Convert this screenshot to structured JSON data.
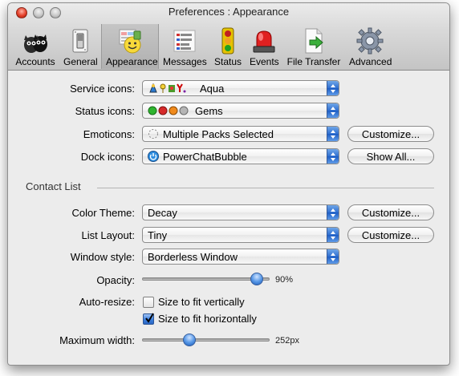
{
  "window": {
    "title": "Preferences : Appearance"
  },
  "toolbar": {
    "items": [
      {
        "label": "Accounts",
        "icon": "accounts-icon"
      },
      {
        "label": "General",
        "icon": "general-switch-icon"
      },
      {
        "label": "Appearance",
        "icon": "appearance-smiley-icon",
        "selected": true
      },
      {
        "label": "Messages",
        "icon": "messages-icon"
      },
      {
        "label": "Status",
        "icon": "traffic-light-icon"
      },
      {
        "label": "Events",
        "icon": "siren-icon"
      },
      {
        "label": "File Transfer",
        "icon": "file-transfer-icon"
      },
      {
        "label": "Advanced",
        "icon": "gear-icon"
      }
    ]
  },
  "appearance": {
    "service_icons": {
      "label": "Service icons:",
      "value": "Aqua"
    },
    "status_icons": {
      "label": "Status icons:",
      "value": "Gems"
    },
    "emoticons": {
      "label": "Emoticons:",
      "value": "Multiple Packs Selected",
      "button": "Customize..."
    },
    "dock_icons": {
      "label": "Dock icons:",
      "value": "PowerChatBubble",
      "button": "Show All..."
    }
  },
  "contact_list": {
    "section_title": "Contact List",
    "color_theme": {
      "label": "Color Theme:",
      "value": "Decay",
      "button": "Customize..."
    },
    "list_layout": {
      "label": "List Layout:",
      "value": "Tiny",
      "button": "Customize..."
    },
    "window_style": {
      "label": "Window style:",
      "value": "Borderless Window"
    },
    "opacity": {
      "label": "Opacity:",
      "value_text": "90%",
      "fraction": 0.9
    },
    "auto_resize": {
      "label": "Auto-resize:",
      "vertical": {
        "label": "Size to fit vertically",
        "checked": false
      },
      "horizontal": {
        "label": "Size to fit horizontally",
        "checked": true
      }
    },
    "max_width": {
      "label": "Maximum width:",
      "value_text": "252px",
      "fraction": 0.37
    }
  },
  "colors": {
    "accent": "#2f6fd0",
    "gem_green": "#2fb52f",
    "gem_red": "#d62a2a",
    "gem_orange": "#f08a1c",
    "gem_gray": "#9a9a9a"
  }
}
